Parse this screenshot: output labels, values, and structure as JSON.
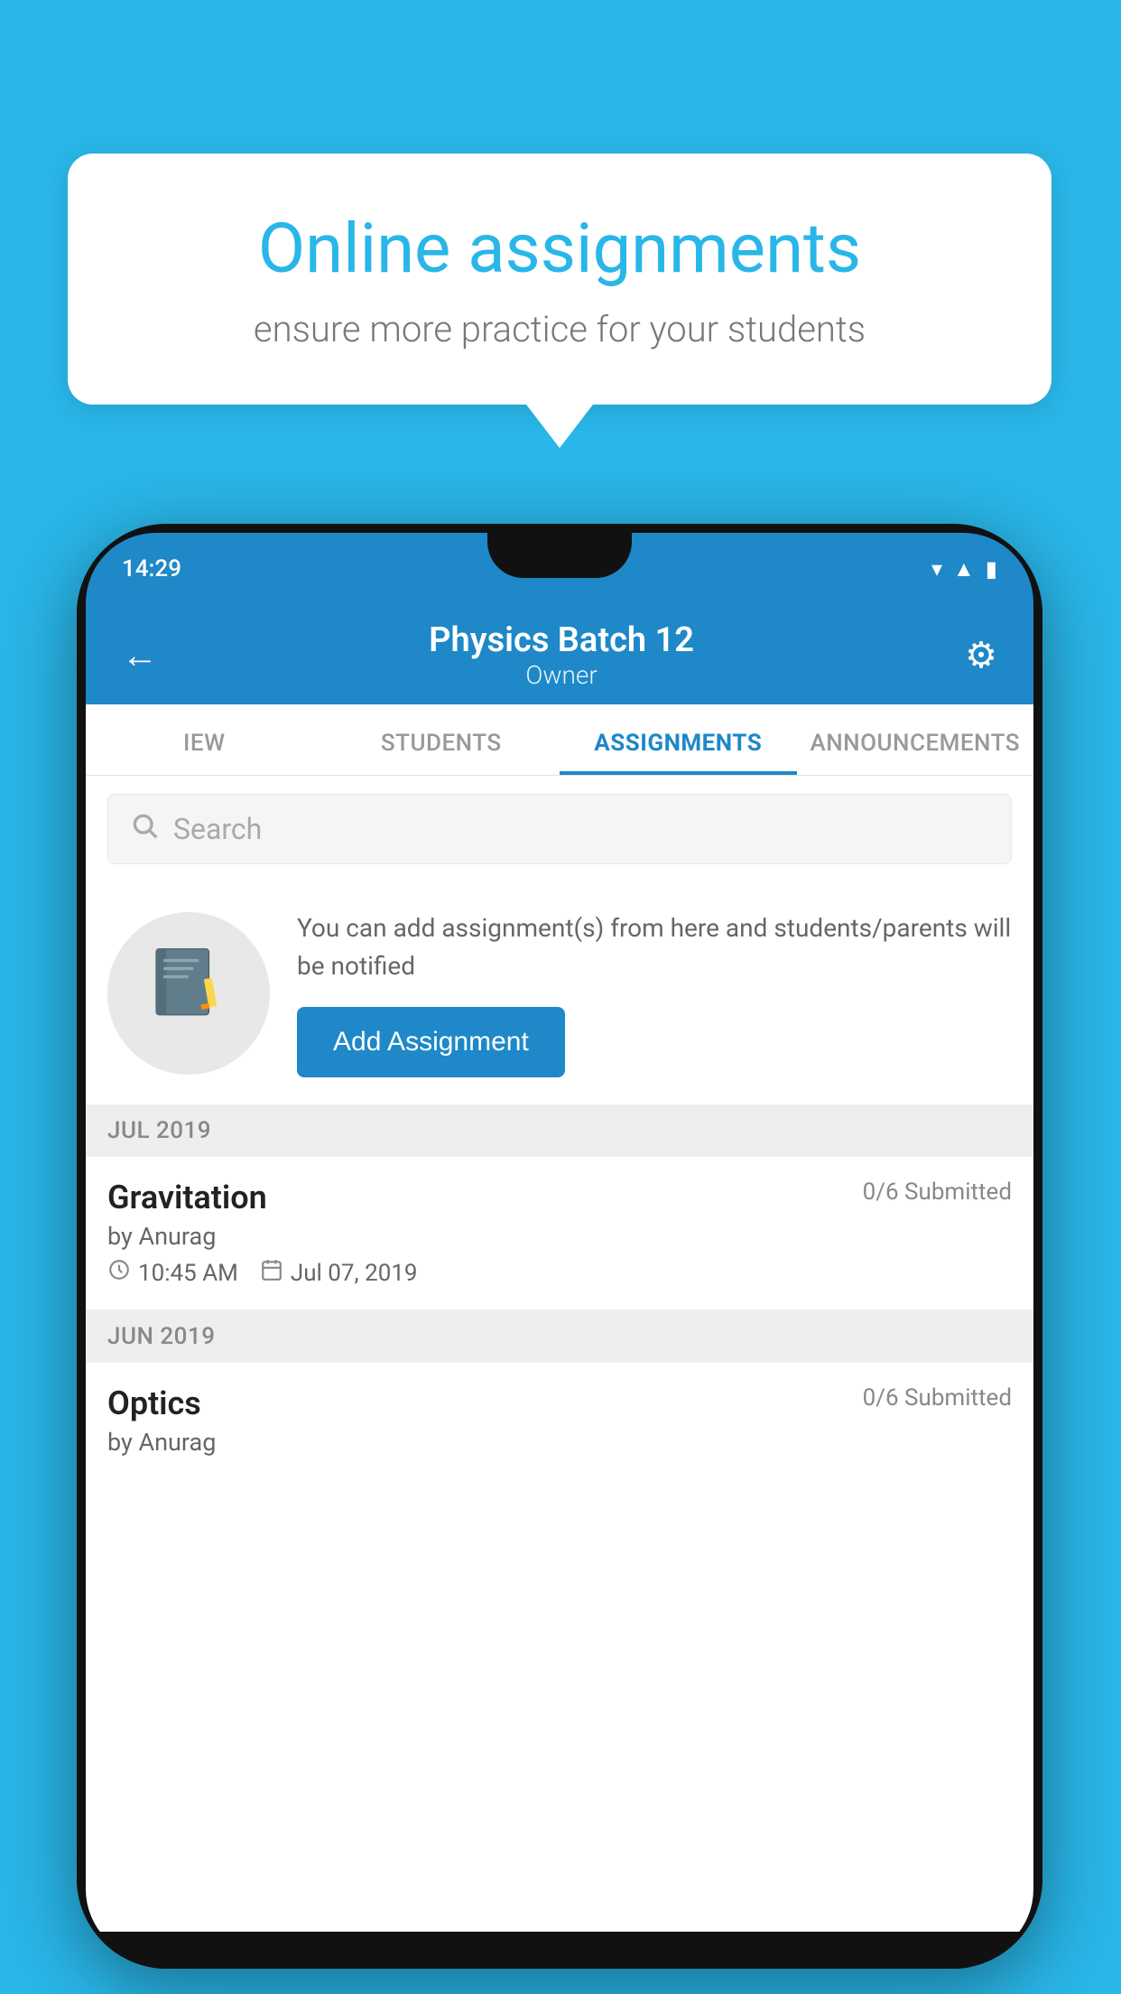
{
  "background": {
    "color": "#29b6e8"
  },
  "speech_bubble": {
    "title": "Online assignments",
    "subtitle": "ensure more practice for your students"
  },
  "phone": {
    "status_bar": {
      "time": "14:29",
      "icons": [
        "wifi",
        "signal",
        "battery"
      ]
    },
    "header": {
      "title": "Physics Batch 12",
      "subtitle": "Owner",
      "back_label": "←",
      "settings_label": "⚙"
    },
    "tabs": [
      {
        "label": "IEW",
        "active": false
      },
      {
        "label": "STUDENTS",
        "active": false
      },
      {
        "label": "ASSIGNMENTS",
        "active": true
      },
      {
        "label": "ANNOUNCEMENTS",
        "active": false
      }
    ],
    "search": {
      "placeholder": "Search"
    },
    "add_assignment": {
      "description": "You can add assignment(s) from here and students/parents will be notified",
      "button_label": "Add Assignment"
    },
    "sections": [
      {
        "label": "JUL 2019",
        "assignments": [
          {
            "name": "Gravitation",
            "submitted": "0/6 Submitted",
            "by": "by Anurag",
            "time": "10:45 AM",
            "date": "Jul 07, 2019"
          }
        ]
      },
      {
        "label": "JUN 2019",
        "assignments": [
          {
            "name": "Optics",
            "submitted": "0/6 Submitted",
            "by": "by Anurag",
            "time": "",
            "date": ""
          }
        ]
      }
    ]
  }
}
